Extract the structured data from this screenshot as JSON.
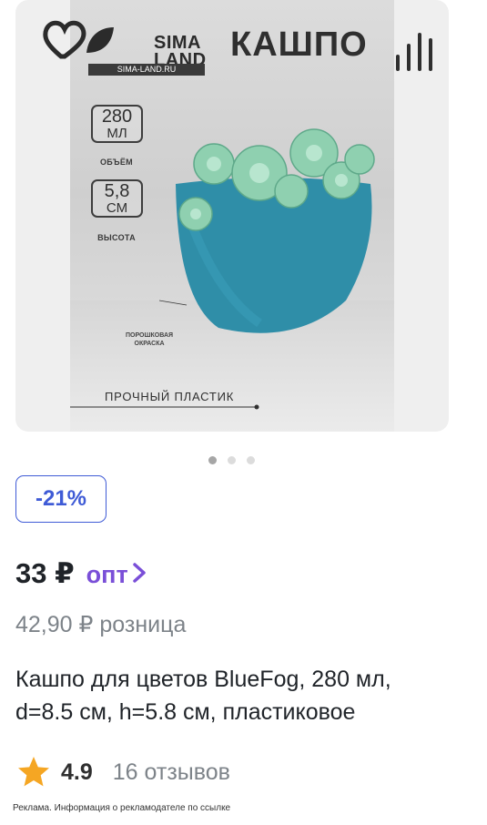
{
  "image": {
    "logo": {
      "line1": "SIMA",
      "line2": "LAND",
      "site": "SIMA-LAND.RU",
      "icon": "heart-leaf-logo"
    },
    "headline": "КАШПО",
    "specs": [
      {
        "value": "280",
        "unit": "МЛ",
        "caption": "ОБЪЁМ"
      },
      {
        "value": "5,8",
        "unit": "СМ",
        "caption": "ВЫСОТА"
      }
    ],
    "note_line1": "ПОРОШКОВАЯ",
    "note_line2": "ОКРАСКА",
    "footer_text": "ПРОЧНЫЙ ПЛАСТИК",
    "colors": {
      "pot": "#2f8ea8",
      "plant": "#8fd0b0"
    }
  },
  "carousel": {
    "count": 3,
    "active_index": 0
  },
  "product": {
    "discount": "-21%",
    "price": "33 ₽",
    "opt_label": "опт",
    "opt_icon": "chevron-right-icon",
    "retail": "42,90 ₽ розница",
    "title_line1": "Кашпо для цветов BlueFog, 280 мл,",
    "title_line2": "d=8.5 см, h=5.8 см, пластиковое",
    "rating": "4.9",
    "reviews": "16 отзывов",
    "star_color": "#f5a623",
    "accent": "#3f5bd6",
    "opt_color": "#7a4fd8"
  },
  "ad_notice": "Реклама. Информация о рекламодателе по ссылке"
}
